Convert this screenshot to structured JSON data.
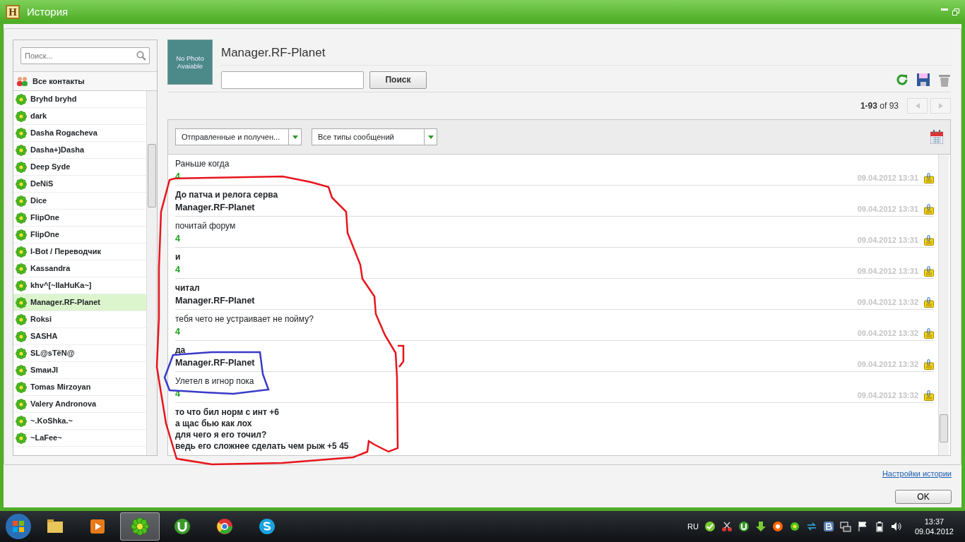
{
  "window": {
    "title": "История",
    "app_letter": "H"
  },
  "contacts_panel": {
    "search_placeholder": "Поиск...",
    "all_contacts": "Все контакты",
    "contacts": [
      {
        "name": "Bryhd bryhd",
        "selected": false
      },
      {
        "name": "dark",
        "selected": false
      },
      {
        "name": "Dasha Rogacheva",
        "selected": false
      },
      {
        "name": "Dasha+)Dasha",
        "selected": false
      },
      {
        "name": "Deep Syde",
        "selected": false
      },
      {
        "name": "DeNiS",
        "selected": false
      },
      {
        "name": "Dice",
        "selected": false
      },
      {
        "name": "FlipOne",
        "selected": false
      },
      {
        "name": "FlipOne",
        "selected": false
      },
      {
        "name": "I-Bot / Переводчик",
        "selected": false
      },
      {
        "name": "Kassandra",
        "selected": false
      },
      {
        "name": "khv^[~IIaHuKa~]",
        "selected": false
      },
      {
        "name": "Manager.RF-Planet",
        "selected": true
      },
      {
        "name": "Roksi",
        "selected": false
      },
      {
        "name": "SASHA",
        "selected": false
      },
      {
        "name": "SL@sTëN@",
        "selected": false
      },
      {
        "name": "SmaиJI",
        "selected": false
      },
      {
        "name": "Tomas Mirzoyan",
        "selected": false
      },
      {
        "name": "Valery Andronova",
        "selected": false
      },
      {
        "name": "~.KoShka.~",
        "selected": false
      },
      {
        "name": "~LaFee~",
        "selected": false
      }
    ]
  },
  "contact": {
    "name": "Manager.RF-Planet",
    "avatar_text": "No Photo Avaiable"
  },
  "search": {
    "button": "Поиск"
  },
  "pagination": {
    "range": "**1-93** of 93",
    "buttons": [
      {
        "kind": "prev",
        "disabled": true
      },
      {
        "kind": "next",
        "disabled": true
      }
    ]
  },
  "filters": [
    {
      "value": "Отправленные и получен..."
    },
    {
      "value": "Все типы сообщений"
    }
  ],
  "messages": [
    {
      "kind": "continuation",
      "text": "Раньше когда"
    },
    {
      "kind": "outgoing",
      "sender": "4",
      "time": "09.04.2012 13:31",
      "text": "До патча и релога серва"
    },
    {
      "kind": "incoming",
      "sender": "Manager.RF-Planet",
      "time": "09.04.2012 13:31",
      "text": "почитай форум"
    },
    {
      "kind": "outgoing",
      "sender": "4",
      "time": "09.04.2012 13:31",
      "text": "и"
    },
    {
      "kind": "outgoing",
      "sender": "4",
      "time": "09.04.2012 13:31",
      "text": "читал"
    },
    {
      "kind": "incoming",
      "sender": "Manager.RF-Planet",
      "time": "09.04.2012 13:32",
      "text": "тебя чето не устраивает не пойму?"
    },
    {
      "kind": "outgoing",
      "sender": "4",
      "time": "09.04.2012 13:32",
      "text": "да"
    },
    {
      "kind": "incoming",
      "sender": "Manager.RF-Planet",
      "time": "09.04.2012 13:32",
      "text": "Улетел в игнор пока"
    },
    {
      "kind": "outgoing",
      "sender": "4",
      "time": "09.04.2012 13:32",
      "text": "то что бил норм с инт +6\nа щас бью как лох\nдля чего я его точил?\nведь его сложнее сделать чем рыж +5 45"
    }
  ],
  "settings_link": "Настройки истории",
  "ok_button": "OK",
  "taskbar": {
    "apps": [
      {
        "kind": "folder",
        "selected": false
      },
      {
        "kind": "player",
        "selected": false
      },
      {
        "kind": "flower",
        "selected": true
      },
      {
        "kind": "torrent",
        "selected": false
      },
      {
        "kind": "browser",
        "selected": false
      },
      {
        "kind": "chat",
        "selected": false
      }
    ],
    "language": "RU",
    "time": "13:37",
    "date": "09.04.2012"
  }
}
